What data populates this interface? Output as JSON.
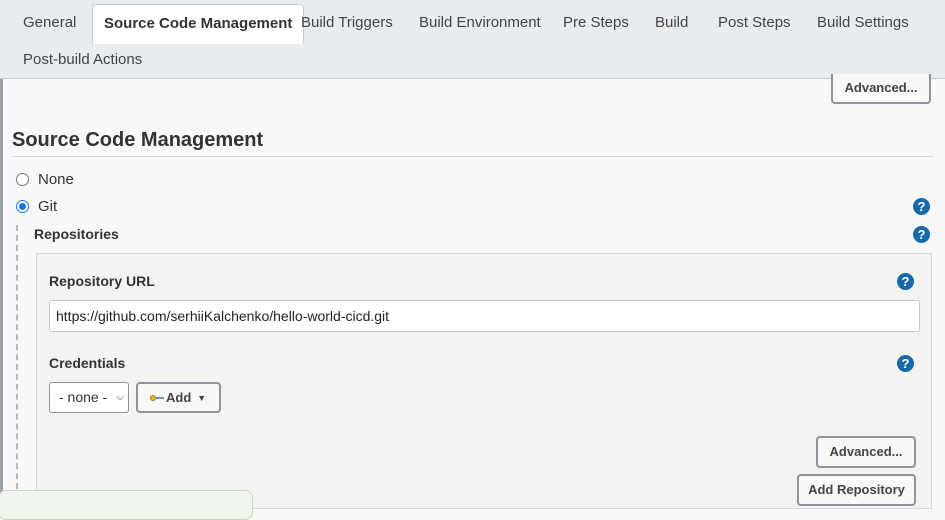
{
  "tabs": [
    {
      "label": "General",
      "active": false
    },
    {
      "label": "Source Code Management",
      "active": true
    },
    {
      "label": "Build Triggers",
      "active": false
    },
    {
      "label": "Build Environment",
      "active": false
    },
    {
      "label": "Pre Steps",
      "active": false
    },
    {
      "label": "Build",
      "active": false
    },
    {
      "label": "Post Steps",
      "active": false
    },
    {
      "label": "Build Settings",
      "active": false
    },
    {
      "label": "Post-build Actions",
      "active": false
    }
  ],
  "top_advanced_label": "Advanced...",
  "scm": {
    "title": "Source Code Management",
    "options": [
      {
        "label": "None",
        "checked": false
      },
      {
        "label": "Git",
        "checked": true
      }
    ],
    "repositories_label": "Repositories",
    "help_symbol": "?",
    "repository": {
      "url_label": "Repository URL",
      "url_value": "https://github.com/serhiiKalchenko/hello-world-cicd.git",
      "credentials_label": "Credentials",
      "credentials_selected": "- none -",
      "add_label": "Add",
      "advanced_label": "Advanced...",
      "add_repository_label": "Add Repository"
    }
  },
  "colors": {
    "accent": "#1a73e8",
    "help_icon": "#1769aa",
    "tab_bar": "#e9ecef"
  },
  "icons": [
    "key-icon",
    "help-icon",
    "chevron-down-icon",
    "caret-down-icon"
  ]
}
